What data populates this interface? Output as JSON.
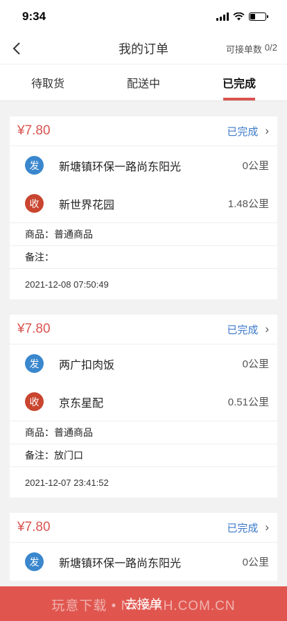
{
  "status_bar": {
    "time": "9:34",
    "battery_level": 0.35
  },
  "nav": {
    "title": "我的订单",
    "right_label": "可接单数",
    "right_value": "0/2"
  },
  "tabs": [
    {
      "label": "待取货"
    },
    {
      "label": "配送中"
    },
    {
      "label": "已完成",
      "active": true
    }
  ],
  "orders": [
    {
      "price": "¥7.80",
      "status": "已完成",
      "from": {
        "badge": "发",
        "name": "新塘镇环保一路尚东阳光",
        "distance": "0公里"
      },
      "to": {
        "badge": "收",
        "name": "新世界花园",
        "distance": "1.48公里"
      },
      "goods_label": "商品：",
      "goods": "普通商品",
      "note_label": "备注：",
      "note": "",
      "time": "2021-12-08 07:50:49"
    },
    {
      "price": "¥7.80",
      "status": "已完成",
      "from": {
        "badge": "发",
        "name": "两广扣肉饭",
        "distance": "0公里"
      },
      "to": {
        "badge": "收",
        "name": "京东星配",
        "distance": "0.51公里"
      },
      "goods_label": "商品：",
      "goods": "普通商品",
      "note_label": "备注：",
      "note": "放门口",
      "time": "2021-12-07 23:41:52"
    },
    {
      "price": "¥7.80",
      "status": "已完成",
      "from": {
        "badge": "发",
        "name": "新塘镇环保一路尚东阳光",
        "distance": "0公里"
      }
    }
  ],
  "bottom": {
    "button_label": "去接单",
    "watermark": "玩意下载 • NXWXH.COM.CN"
  },
  "colors": {
    "accent": "#d9534f",
    "link": "#3a78c8",
    "send_badge": "#3a87cd",
    "recv_badge": "#c9452f",
    "bottom_bar": "#e0564f"
  }
}
